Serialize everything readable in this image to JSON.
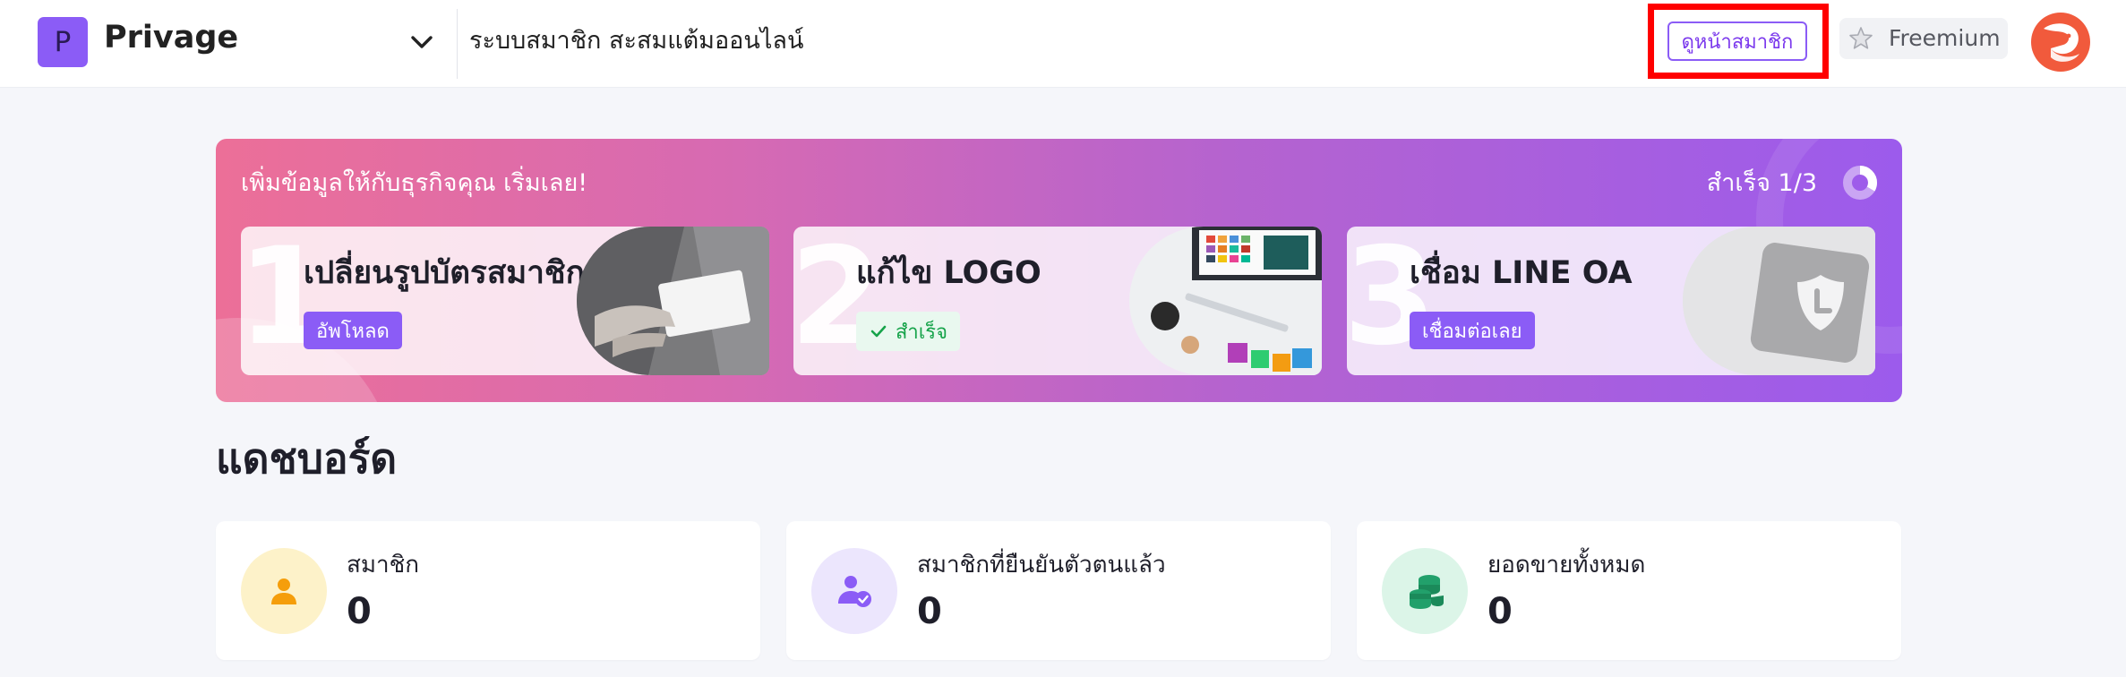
{
  "header": {
    "brand_initial": "P",
    "brand_name": "Privage",
    "subtitle": "ระบบสมาชิก สะสมแต้มออนไลน์",
    "view_member_label": "ดูหน้าสมาชิก",
    "plan_label": "Freemium",
    "highlight_color": "#ff0000",
    "accent_color": "#8b5cf6"
  },
  "onboarding": {
    "title": "เพิ่มข้อมูลให้กับธุรกิจคุณ เริ่มเลย!",
    "progress_text": "สำเร็จ 1/3",
    "progress_fraction": 0.3333,
    "steps": [
      {
        "number": "1",
        "title": "เปลี่ยนรูปบัตรสมาชิก",
        "action_label": "อัพโหลด",
        "done": false,
        "icon": "member-card-photo"
      },
      {
        "number": "2",
        "title": "แก้ไข LOGO",
        "action_label": "สำเร็จ",
        "done": true,
        "icon": "desk-workspace-photo"
      },
      {
        "number": "3",
        "title": "เชื่อม LINE OA",
        "action_label": "เชื่อมต่อเลย",
        "done": false,
        "icon": "line-shield-icon"
      }
    ]
  },
  "dashboard": {
    "title": "แดชบอร์ด",
    "stats": [
      {
        "label": "สมาชิก",
        "value": "0",
        "icon": "user-icon",
        "icon_color": "#f59e0b",
        "icon_bg": "#fdf2c9"
      },
      {
        "label": "สมาชิกที่ยืนยันตัวตนแล้ว",
        "value": "0",
        "icon": "verified-user-icon",
        "icon_color": "#8b5cf6",
        "icon_bg": "#ece6fd"
      },
      {
        "label": "ยอดขายทั้งหมด",
        "value": "0",
        "icon": "coins-icon",
        "icon_color": "#22a06b",
        "icon_bg": "#dcf5e8"
      }
    ]
  }
}
